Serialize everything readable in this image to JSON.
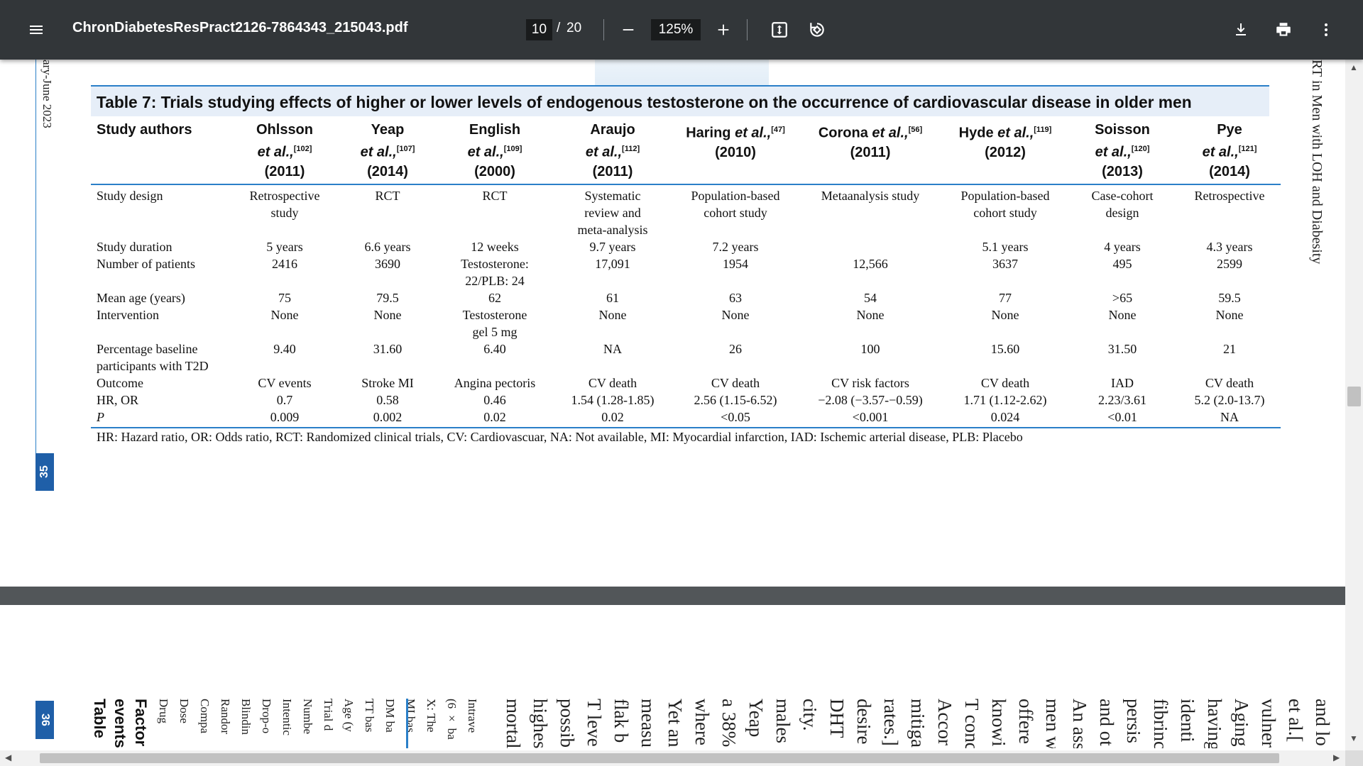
{
  "toolbar": {
    "title": "ChronDiabetesResPract2126-7864343_215043.pdf",
    "page_current": "10",
    "page_sep": "/",
    "page_total": "20",
    "zoom": "125%"
  },
  "page1": {
    "side_journal": "ary-June 2023",
    "page_number": "35",
    "right_running": "RT in Men with LOH and Diabesity",
    "caption": "Table 7: Trials studying effects of higher or lower levels of endogenous testosterone on the occurrence of cardiovascular disease in older men",
    "header_first": "Study authors",
    "studies": [
      {
        "name": "Ohlsson",
        "etal": "et al.,",
        "ref": "[102]",
        "year": "(2011)",
        "layout": "three"
      },
      {
        "name": "Yeap",
        "etal": "et al.,",
        "ref": "[107]",
        "year": "(2014)",
        "layout": "three"
      },
      {
        "name": "English",
        "etal": "et al.,",
        "ref": "[109]",
        "year": "(2000)",
        "layout": "three"
      },
      {
        "name": "Araujo",
        "etal": "et al.,",
        "ref": "[112]",
        "year": "(2011)",
        "layout": "three"
      },
      {
        "name": "Haring",
        "etal": "et al.,",
        "ref": "[47]",
        "year": "(2010)",
        "layout": "two"
      },
      {
        "name": "Corona",
        "etal": "et al.,",
        "ref": "[56]",
        "year": "(2011)",
        "layout": "two"
      },
      {
        "name": "Hyde",
        "etal": "et al.,",
        "ref": "[119]",
        "year": "(2012)",
        "layout": "two"
      },
      {
        "name": "Soisson",
        "etal": "et al.,",
        "ref": "[120]",
        "year": "(2013)",
        "layout": "three"
      },
      {
        "name": "Pye",
        "etal": "et al.,",
        "ref": "[121]",
        "year": "(2014)",
        "layout": "three"
      }
    ],
    "rows": [
      {
        "label": [
          "Study design"
        ],
        "cells": [
          [
            "Retrospective",
            "study"
          ],
          [
            "RCT"
          ],
          [
            "RCT"
          ],
          [
            "Systematic",
            "review and",
            "meta-analysis"
          ],
          [
            "Population-based",
            "cohort study"
          ],
          [
            "Metaanalysis study"
          ],
          [
            "Population-based",
            "cohort study"
          ],
          [
            "Case-cohort",
            "design"
          ],
          [
            "Retrospective"
          ]
        ]
      },
      {
        "label": [
          "Study duration"
        ],
        "cells": [
          [
            "5 years"
          ],
          [
            "6.6 years"
          ],
          [
            "12 weeks"
          ],
          [
            "9.7 years"
          ],
          [
            "7.2 years"
          ],
          [
            ""
          ],
          [
            "5.1 years"
          ],
          [
            "4 years"
          ],
          [
            "4.3 years"
          ]
        ]
      },
      {
        "label": [
          "Number of patients"
        ],
        "cells": [
          [
            "2416"
          ],
          [
            "3690"
          ],
          [
            "Testosterone:",
            "22/PLB: 24"
          ],
          [
            "17,091"
          ],
          [
            "1954"
          ],
          [
            "12,566"
          ],
          [
            "3637"
          ],
          [
            "495"
          ],
          [
            "2599"
          ]
        ]
      },
      {
        "label": [
          "Mean age (years)"
        ],
        "cells": [
          [
            "75"
          ],
          [
            "79.5"
          ],
          [
            "62"
          ],
          [
            "61"
          ],
          [
            "63"
          ],
          [
            "54"
          ],
          [
            "77"
          ],
          [
            ">65"
          ],
          [
            "59.5"
          ]
        ]
      },
      {
        "label": [
          "Intervention"
        ],
        "cells": [
          [
            "None"
          ],
          [
            "None"
          ],
          [
            "Testosterone",
            "gel 5 mg"
          ],
          [
            "None"
          ],
          [
            "None"
          ],
          [
            "None"
          ],
          [
            "None"
          ],
          [
            "None"
          ],
          [
            "None"
          ]
        ]
      },
      {
        "label": [
          "Percentage baseline",
          "participants with T2D"
        ],
        "cells": [
          [
            "9.40"
          ],
          [
            "31.60"
          ],
          [
            "6.40"
          ],
          [
            "NA"
          ],
          [
            "26"
          ],
          [
            "100"
          ],
          [
            "15.60"
          ],
          [
            "31.50"
          ],
          [
            "21"
          ]
        ]
      },
      {
        "label": [
          "Outcome"
        ],
        "cells": [
          [
            "CV events"
          ],
          [
            "Stroke MI"
          ],
          [
            "Angina pectoris"
          ],
          [
            "CV death"
          ],
          [
            "CV death"
          ],
          [
            "CV risk factors"
          ],
          [
            "CV death"
          ],
          [
            "IAD"
          ],
          [
            "CV death"
          ]
        ]
      },
      {
        "label": [
          "HR, OR"
        ],
        "cells": [
          [
            "0.7"
          ],
          [
            "0.58"
          ],
          [
            "0.46"
          ],
          [
            "1.54 (1.28-1.85)"
          ],
          [
            "2.56 (1.15-6.52)"
          ],
          [
            "−2.08 (−3.57-−0.59)"
          ],
          [
            "1.71 (1.12-2.62)"
          ],
          [
            "2.23/3.61"
          ],
          [
            "5.2 (2.0-13.7)"
          ]
        ]
      },
      {
        "label": [
          "P"
        ],
        "italic_label": true,
        "cells": [
          [
            "0.009"
          ],
          [
            "0.002"
          ],
          [
            "0.02"
          ],
          [
            "0.02"
          ],
          [
            "<0.05"
          ],
          [
            "<0.001"
          ],
          [
            "0.024"
          ],
          [
            "<0.01"
          ],
          [
            "NA"
          ]
        ]
      }
    ],
    "footnote": "HR: Hazard ratio, OR: Odds ratio, RCT: Randomized clinical trials, CV: Cardiovascuar, NA: Not available, MI: Myocardial infarction, IAD: Ischemic arterial disease, PLB: Placebo"
  },
  "page2": {
    "page_number": "36",
    "left_cols": [
      "Intrave",
      "(6 × ba",
      "X: The",
      "MI bas",
      "DM ba",
      "TT bas",
      "Age (y",
      "Trial d",
      "Numbe",
      "Intentic",
      "Drop-o",
      "Blindin",
      "Randor",
      "Compa",
      "Dose",
      "Drug"
    ],
    "table_head": [
      "Factor",
      "events",
      "Table"
    ],
    "right_cols": [
      "and lo",
      "et al.[",
      "vulner",
      "Aging",
      "having",
      "identi",
      "fibrinc",
      "persis",
      "and ot",
      "An ass",
      "men w",
      "offere",
      "knowi",
      "T conc",
      "Accor",
      "mitiga",
      "rates.]",
      "desire",
      "DHT",
      "city.",
      "males",
      "Yeap",
      "a 38%",
      "where",
      "Yet an",
      "measu",
      "flak b",
      "T leve",
      "possib",
      "highes",
      "mortal"
    ]
  },
  "colors": {
    "toolbar": "#323639",
    "accent": "#2a7fc8",
    "page_tab": "#1f5fa8",
    "caption_bg": "#e6eef8"
  },
  "icons": [
    "menu-icon",
    "minus-icon",
    "plus-icon",
    "fit-page-icon",
    "rotate-icon",
    "download-icon",
    "print-icon",
    "more-vert-icon"
  ]
}
